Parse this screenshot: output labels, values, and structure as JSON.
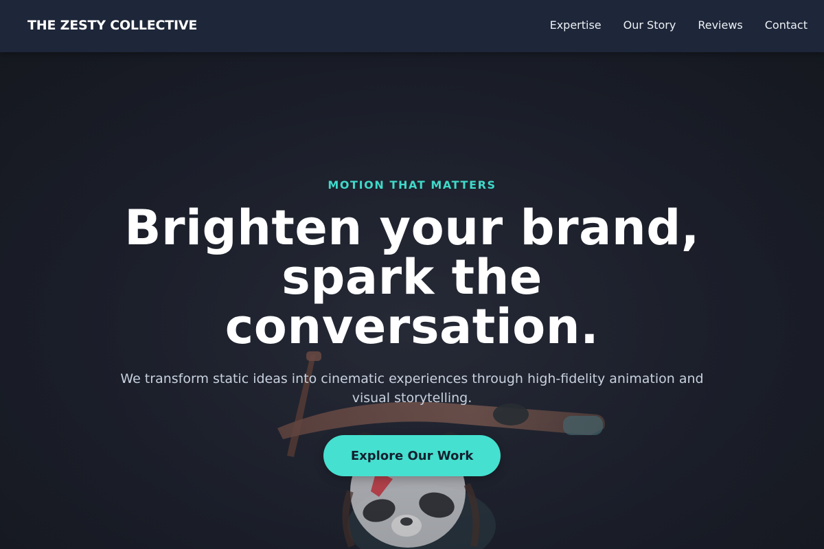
{
  "header": {
    "brand": "THE ZESTY COLLECTIVE",
    "nav": [
      {
        "label": "Expertise"
      },
      {
        "label": "Our Story"
      },
      {
        "label": "Reviews"
      },
      {
        "label": "Contact"
      }
    ]
  },
  "hero": {
    "eyebrow": "MOTION THAT MATTERS",
    "headline": "Brighten your brand, spark the conversation.",
    "subtext": "We transform static ideas into cinematic experiences through high-fidelity animation and visual storytelling.",
    "cta_label": "Explore Our Work",
    "background_illustration": "panda-with-staff-icon"
  },
  "colors": {
    "header_bg": "#1e2739",
    "page_bg": "#1f2330",
    "accent": "#45e0cf",
    "eyebrow": "#3fd9c9",
    "headline": "#ffffff",
    "subtext": "#c9d2e0"
  }
}
